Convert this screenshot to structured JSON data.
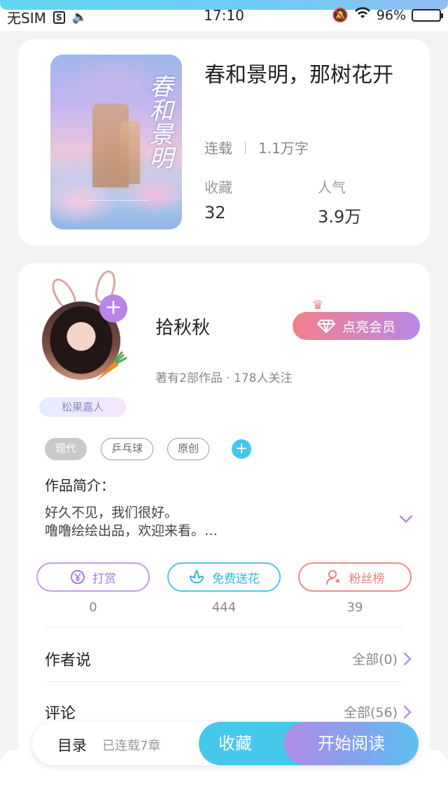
{
  "status_bar": {
    "carrier": "无SIM",
    "time": "17:10",
    "battery_text": "96%",
    "battery_level": 0.96
  },
  "book": {
    "title": "春和景明，那树花开",
    "status": "连载",
    "word_count": "1.1万字",
    "favorites_label": "收藏",
    "favorites_value": "32",
    "popularity_label": "人气",
    "popularity_value": "3.9万",
    "cover_art_text": "春和景明"
  },
  "author": {
    "name": "拾秋秋",
    "meta": "著有2部作品 · 178人关注",
    "badge": "松果嘉人",
    "vip_button": "点亮会员"
  },
  "tags": [
    "现代",
    "乒乓球",
    "原创"
  ],
  "intro": {
    "title": "作品简介：",
    "text": "好久不见，我们很好。\n噜噜绘绘出品，欢迎来看。…"
  },
  "actions": [
    {
      "label": "打赏",
      "count": "0",
      "icon": "yuan-coin-icon"
    },
    {
      "label": "免费送花",
      "count": "444",
      "icon": "flower-icon"
    },
    {
      "label": "粉丝榜",
      "count": "39",
      "icon": "person-icon"
    }
  ],
  "rows": {
    "author_says": {
      "label": "作者说",
      "link": "全部(0)"
    },
    "comments": {
      "label": "评论",
      "link": "全部(56)"
    }
  },
  "bottom_bar": {
    "toc": "目录",
    "chapters": "已连载7章",
    "collect": "收藏",
    "read": "开始阅读"
  },
  "colors": {
    "accent_blue": "#46c8ec",
    "accent_purple": "#b785e8",
    "accent_pink": "#f47f8c"
  }
}
